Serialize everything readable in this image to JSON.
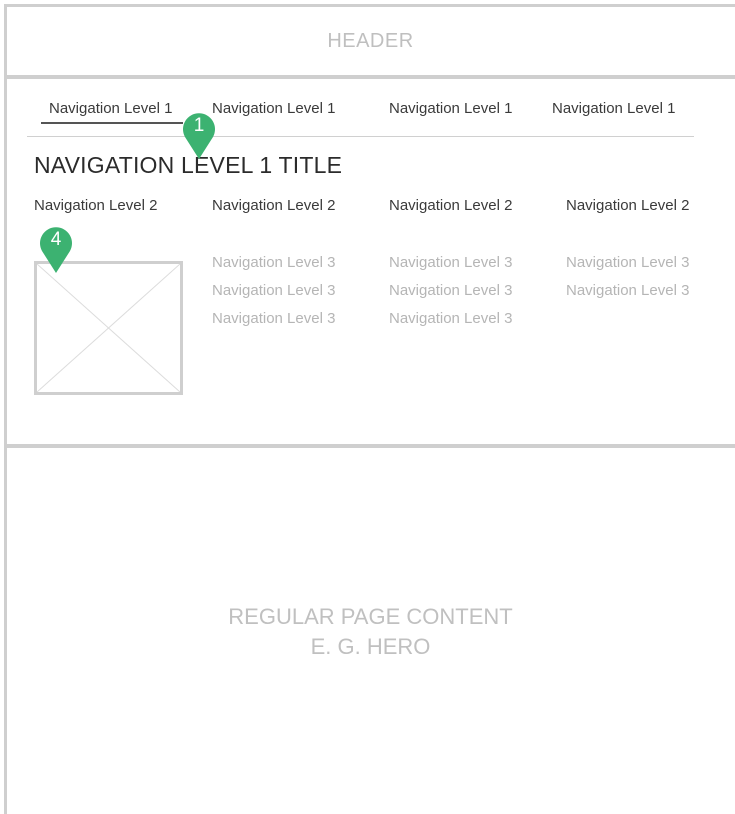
{
  "header": {
    "label": "HEADER"
  },
  "nav_level1": {
    "items": [
      "Navigation Level 1",
      "Navigation Level 1",
      "Navigation Level 1",
      "Navigation Level 1"
    ],
    "title": "NAVIGATION LEVEL 1 TITLE"
  },
  "nav_level2": {
    "items": [
      "Navigation Level 2",
      "Navigation Level 2",
      "Navigation Level 2",
      "Navigation Level 2"
    ]
  },
  "nav_level3": {
    "columns": [
      [
        "Navigation Level 3",
        "Navigation Level 3",
        "Navigation Level 3"
      ],
      [
        "Navigation Level 3",
        "Navigation Level 3",
        "Navigation Level 3"
      ],
      [
        "Navigation Level 3",
        "Navigation Level 3"
      ]
    ]
  },
  "markers": [
    {
      "number": "1"
    },
    {
      "number": "4"
    }
  ],
  "content": {
    "line1": "REGULAR PAGE CONTENT",
    "line2": "E. G. HERO"
  },
  "colors": {
    "marker": "#3cb271",
    "frame": "#cfcfcf",
    "muted_text": "#b5b5b5"
  }
}
